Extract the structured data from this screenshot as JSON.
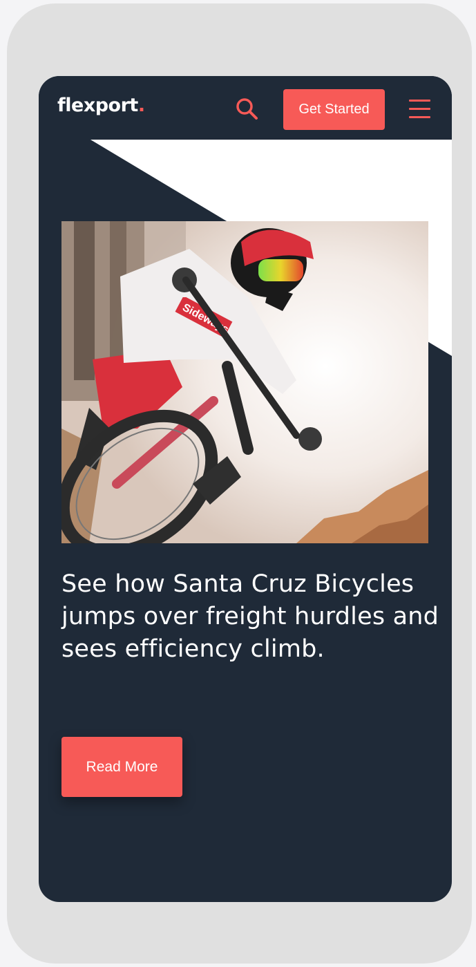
{
  "header": {
    "logo_text": "flexport",
    "logo_dot": ".",
    "cta_label": "Get Started",
    "search_icon": "search-icon",
    "menu_icon": "hamburger-menu-icon"
  },
  "hero": {
    "image_subject": "mountain-bike-rider-photo",
    "headline": "See how Santa Cruz Bicycles jumps over freight hurdles and sees efficiency climb.",
    "read_more_label": "Read More",
    "jersey_text": "Sideways"
  },
  "colors": {
    "accent": "#f75a57",
    "navy": "#1f2a38",
    "white": "#ffffff",
    "device_frame": "#e0e0e0"
  }
}
